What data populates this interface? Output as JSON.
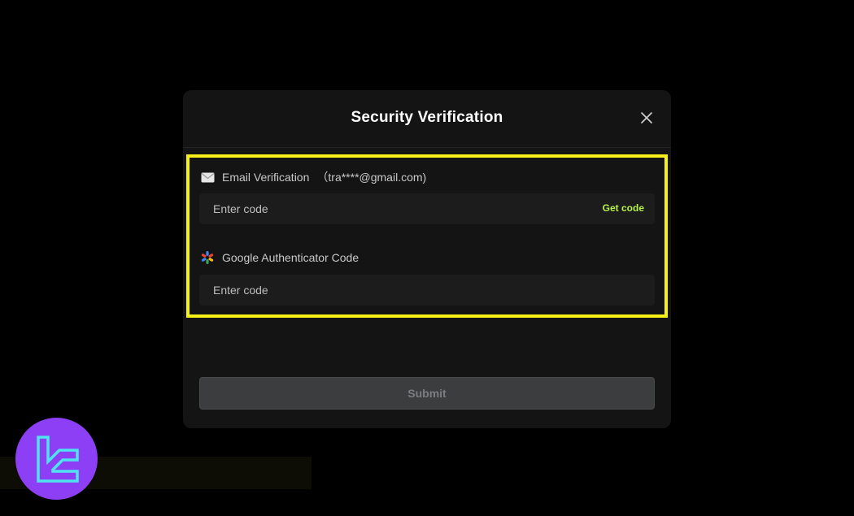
{
  "modal": {
    "title": "Security Verification",
    "email": {
      "label": "Email Verification",
      "address": "（tra****@gmail.com)",
      "placeholder": "Enter code",
      "get_code_label": "Get code"
    },
    "google_auth": {
      "label": "Google Authenticator Code",
      "placeholder": "Enter code"
    },
    "submit_label": "Submit"
  },
  "colors": {
    "highlight": "#f4f018",
    "get_code": "#b6f24a",
    "logo_bg": "#8d3ff5",
    "logo_mark": "#4fe3f0"
  },
  "icons": {
    "close": "close-icon",
    "email": "envelope-icon",
    "google_auth": "google-authenticator-icon",
    "logo": "brand-logo-icon"
  }
}
